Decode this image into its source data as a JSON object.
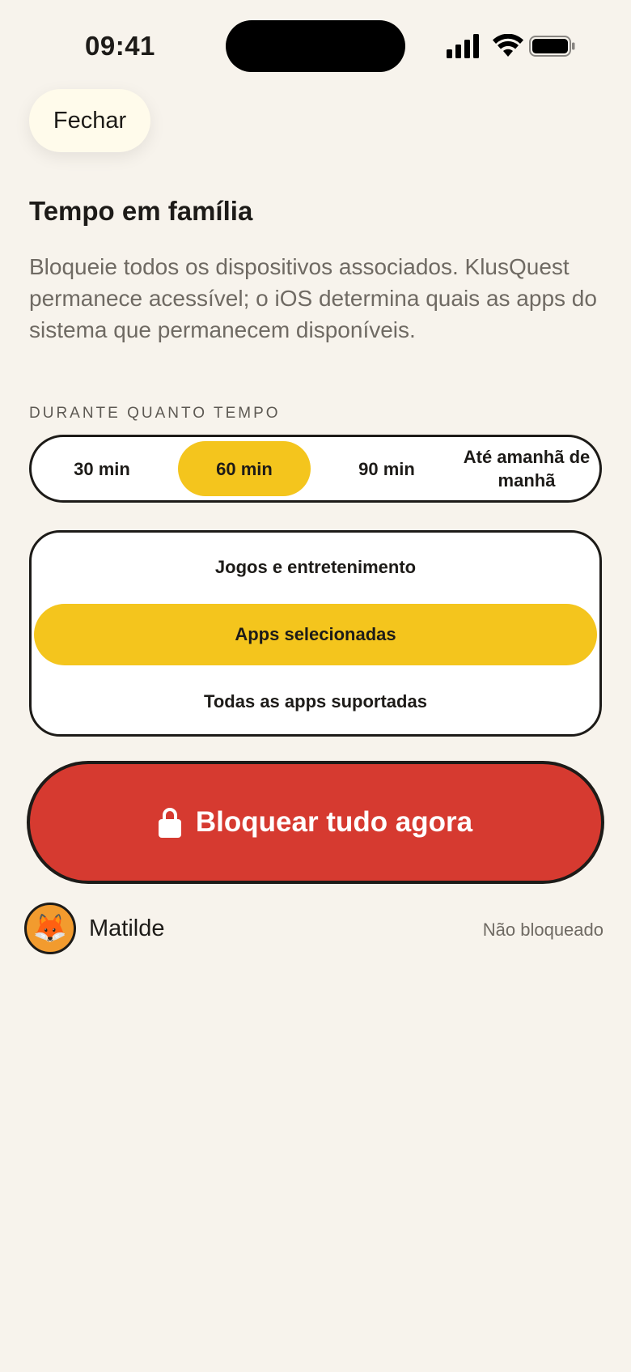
{
  "status_bar": {
    "time": "09:41",
    "icons": [
      "cellular-signal-icon",
      "wifi-icon",
      "battery-icon"
    ]
  },
  "header": {
    "close_label": "Fechar"
  },
  "main": {
    "title": "Tempo em família",
    "description": "Bloqueie todos os dispositivos associados. KlusQuest permanece acessível; o iOS determina quais as apps do sistema que permanecem disponíveis.",
    "duration_label": "DURANTE QUANTO TEMPO",
    "duration_options": [
      {
        "label": "30 min",
        "selected": false
      },
      {
        "label": "60 min",
        "selected": true
      },
      {
        "label": "90 min",
        "selected": false
      },
      {
        "label": "Até amanhã de manhã",
        "selected": false
      }
    ],
    "scope_options": [
      {
        "label": "Jogos e entretenimento",
        "selected": false
      },
      {
        "label": "Apps selecionadas",
        "selected": true
      },
      {
        "label": "Todas as apps suportadas",
        "selected": false
      }
    ],
    "lock_button": {
      "label": "Bloquear tudo agora",
      "icon": "lock-icon"
    }
  },
  "members": [
    {
      "avatar": "🦊",
      "name": "Matilde",
      "status": "Não bloqueado"
    }
  ],
  "colors": {
    "background": "#f7f3ec",
    "accent_yellow": "#f4c51d",
    "lock_red": "#d63a30",
    "outline": "#1d1b18",
    "avatar_orange": "#f29b2e"
  }
}
